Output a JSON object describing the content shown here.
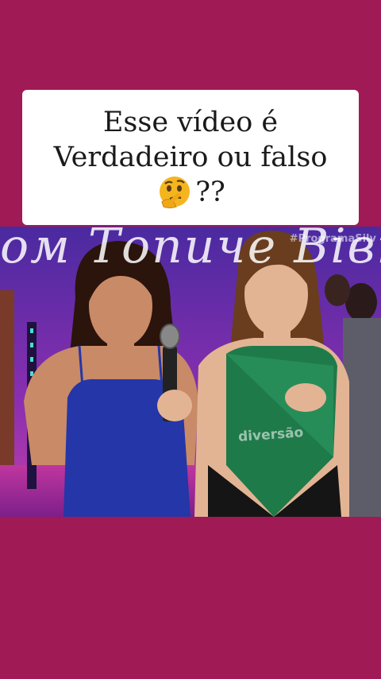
{
  "caption": {
    "line1": "Esse vídeo é",
    "line2": "Verdadeiro ou falso",
    "line3_suffix": "??",
    "emoji": "thinking-face-emoji"
  },
  "video": {
    "watermark": "#ProgramaSilv",
    "stage_text": "ом Топиче Вівю",
    "shirt_logo": "diversão"
  },
  "colors": {
    "background": "#a01a55",
    "caption_box": "#ffffff",
    "stage_purple": "#3d1f8a",
    "stage_magenta": "#c0369f"
  }
}
